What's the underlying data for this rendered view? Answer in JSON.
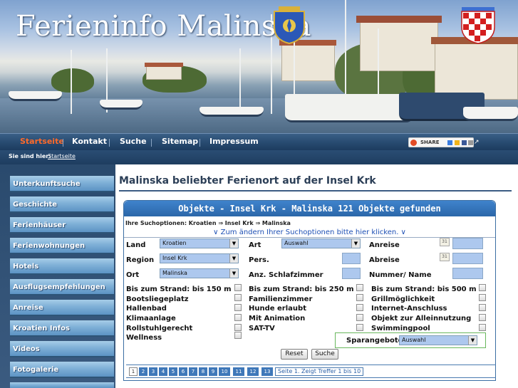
{
  "header": {
    "site_title": "Ferieninfo Malinska"
  },
  "nav": {
    "items": [
      {
        "label": "Startseite",
        "active": true
      },
      {
        "label": "Kontakt",
        "active": false
      },
      {
        "label": "Suche",
        "active": false
      },
      {
        "label": "Sitemap",
        "active": false
      },
      {
        "label": "Impressum",
        "active": false
      }
    ],
    "share_label": "SHARE"
  },
  "breadcrumb": {
    "label": "Sie sind hier:",
    "link": "Startseite"
  },
  "sidebar": {
    "items": [
      {
        "label": "Unterkunftsuche"
      },
      {
        "label": "Geschichte"
      },
      {
        "label": "Ferienhäuser"
      },
      {
        "label": "Ferienwohnungen"
      },
      {
        "label": "Hotels"
      },
      {
        "label": "Ausflugsempfehlungen"
      },
      {
        "label": "Anreise"
      },
      {
        "label": "Kroatien Infos"
      },
      {
        "label": "Videos"
      },
      {
        "label": "Fotogalerie"
      }
    ]
  },
  "main": {
    "title": "Malinska beliebter Ferienort auf der Insel Krk",
    "panel_title": "Objekte - Insel Krk - Malinska 121 Objekte gefunden",
    "options_label": "Ihre Suchoptionen: Kroatien ⇒ Insel Krk ⇒ Malinska",
    "options_link": "∨ Zum ändern Ihrer Suchoptionen bitte hier klicken. ∨",
    "form": {
      "land_label": "Land",
      "land_value": "Kroatien",
      "region_label": "Region",
      "region_value": "Insel Krk",
      "ort_label": "Ort",
      "ort_value": "Malinska",
      "art_label": "Art",
      "art_value": "Auswahl",
      "pers_label": "Pers.",
      "schlaf_label": "Anz. Schlafzimmer",
      "anreise_label": "Anreise",
      "abreise_label": "Abreise",
      "nummer_label": "Nummer/ Name"
    },
    "features": {
      "col1": [
        "Bis zum Strand: bis 150 m",
        "Bootsliegeplatz",
        "Hallenbad",
        "Klimaanlage",
        "Rollstuhlgerecht",
        "Wellness"
      ],
      "col2": [
        "Bis zum Strand: bis 250 m",
        "Familienzimmer",
        "Hunde erlaubt",
        "Mit Animation",
        "SAT-TV"
      ],
      "col3": [
        "Bis zum Strand: bis 500 m",
        "Grillmöglichkeit",
        "Internet-Anschluss",
        "Objekt zur Alleinnutzung",
        "Swimmingpool"
      ]
    },
    "sparangebote_label": "Sparangebote",
    "sparangebote_value": "Auswahl",
    "reset_label": "Reset",
    "search_label": "Suche",
    "pager": {
      "pages": [
        "1",
        "2",
        "3",
        "4",
        "5",
        "6",
        "7",
        "8",
        "9",
        "10",
        "11",
        "12",
        "13"
      ],
      "current": "1",
      "info": "Seite 1. Zeigt Treffer 1 bis 10"
    }
  },
  "colors": {
    "nav_bg": "#274a70",
    "active_nav": "#ff6a2a",
    "panel_head": "#2b67a9",
    "link": "#1d4fb4"
  }
}
